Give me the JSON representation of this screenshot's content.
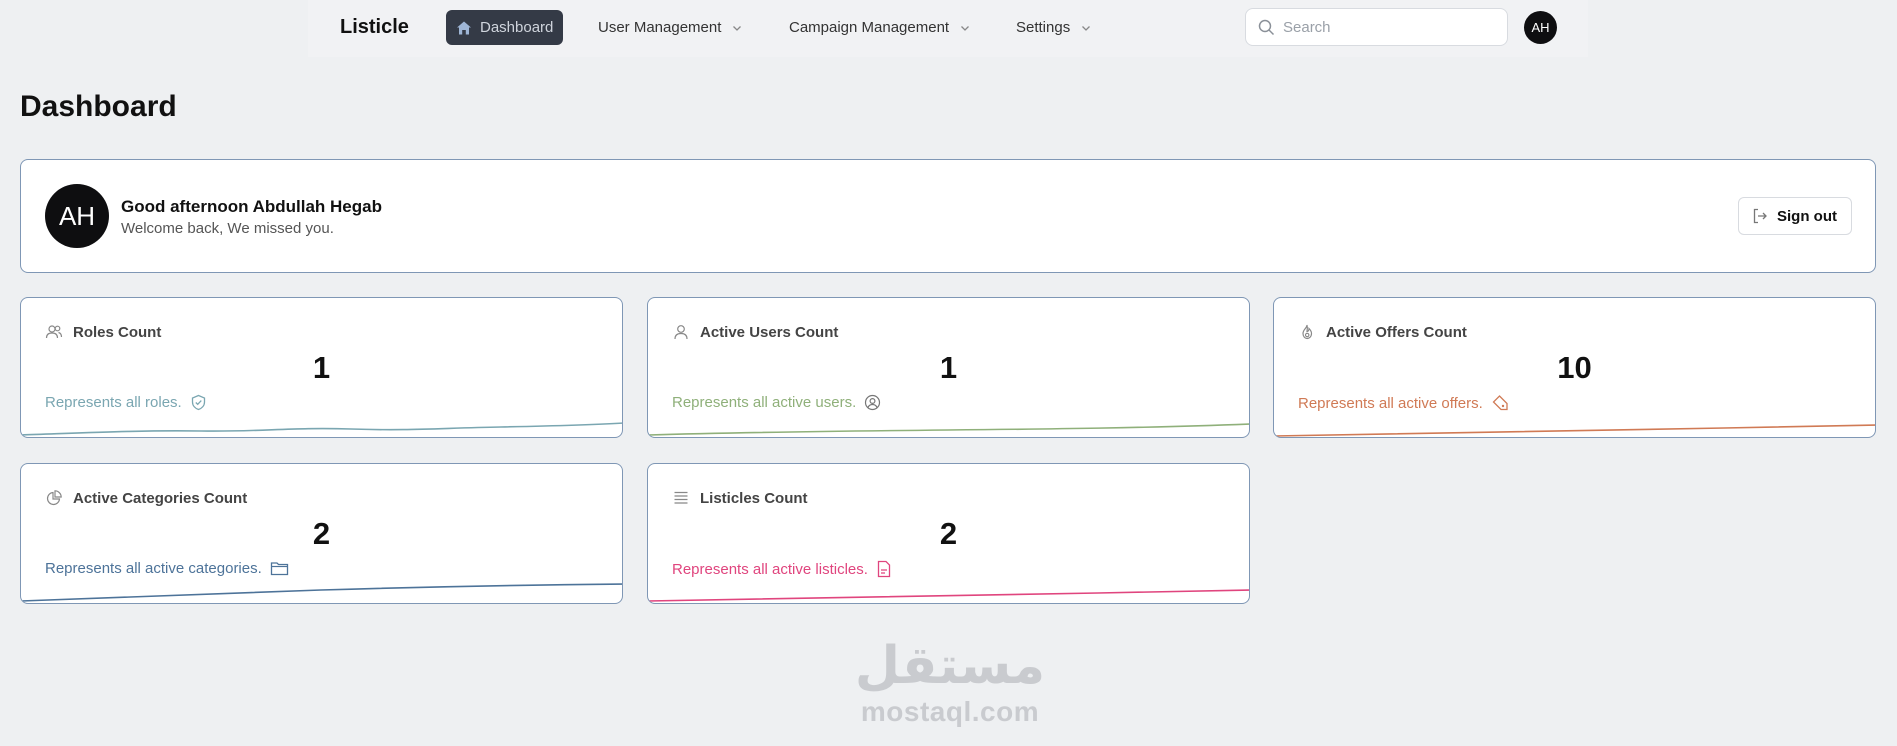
{
  "nav": {
    "brand": "Listicle",
    "items": [
      {
        "label": "Dashboard",
        "icon": "home-icon",
        "active": true
      },
      {
        "label": "User Management",
        "icon": "chevron-down-icon"
      },
      {
        "label": "Campaign Management",
        "icon": "chevron-down-icon"
      },
      {
        "label": "Settings",
        "icon": "chevron-down-icon"
      }
    ],
    "search_placeholder": "Search",
    "avatar_initials": "AH"
  },
  "page_title": "Dashboard",
  "welcome": {
    "avatar_initials": "AH",
    "greeting": "Good afternoon Abdullah Hegab",
    "subtitle": "Welcome back, We missed you.",
    "signout_label": "Sign out"
  },
  "cards": [
    {
      "title": "Roles Count",
      "value": "1",
      "description": "Represents all roles.",
      "color": "#7aa6b1",
      "icon": "users-icon",
      "desc_icon": "shield-check-icon"
    },
    {
      "title": "Active Users Count",
      "value": "1",
      "description": "Represents all active users.",
      "color": "#8fb07a",
      "icon": "user-icon",
      "desc_icon": "user-circle-icon"
    },
    {
      "title": "Active Offers Count",
      "value": "10",
      "description": "Represents all active offers.",
      "color": "#d07a55",
      "icon": "flame-icon",
      "desc_icon": "tag-icon"
    },
    {
      "title": "Active Categories Count",
      "value": "2",
      "description": "Represents all active categories.",
      "color": "#4d7399",
      "icon": "pie-chart-icon",
      "desc_icon": "folder-icon"
    },
    {
      "title": "Listicles Count",
      "value": "2",
      "description": "Represents all active listicles.",
      "color": "#e0457e",
      "icon": "list-icon",
      "desc_icon": "file-icon"
    }
  ],
  "watermark": {
    "arabic": "مستقل",
    "latin": "mostaql.com"
  }
}
